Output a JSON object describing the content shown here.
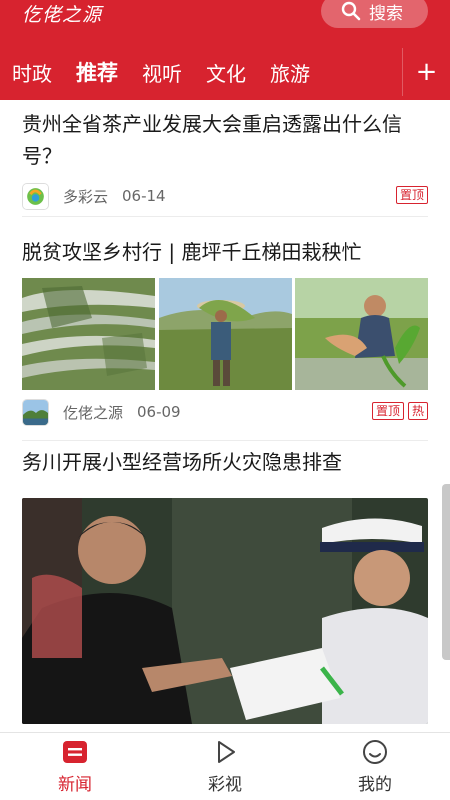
{
  "header": {
    "logo_text": "仡佬之源",
    "search_label": "搜索",
    "tabs": [
      "时政",
      "推荐",
      "视听",
      "文化",
      "旅游"
    ],
    "active_tab": "推荐",
    "add_label": "+"
  },
  "articles": [
    {
      "title": "贵州全省茶产业发展大会重启透露出什么信号？",
      "source": "多彩云",
      "date": "06-14",
      "badges": [
        "置顶"
      ]
    },
    {
      "title": "脱贫攻坚乡村行 | 鹿坪千丘梯田栽秧忙",
      "source": "仡佬之源",
      "date": "06-09",
      "badges": [
        "置顶",
        "热"
      ]
    },
    {
      "title": "务川开展小型经营场所火灾隐患排查"
    }
  ],
  "bottom_nav": {
    "news": "新闻",
    "video": "彩视",
    "mine": "我的"
  },
  "colors": {
    "brand_red": "#d7232f"
  }
}
